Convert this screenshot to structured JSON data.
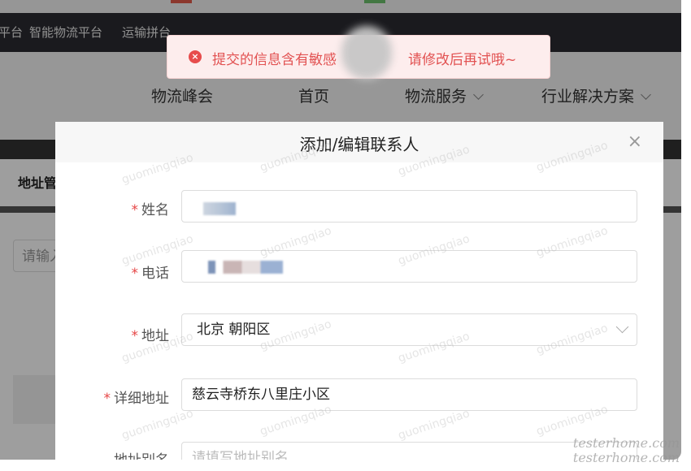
{
  "topbar": {
    "links": [
      "平台",
      "智能物流平台",
      "运输拼台"
    ]
  },
  "nav": {
    "items": [
      "物流峰会",
      "首页",
      "物流服务",
      "行业解决方案"
    ]
  },
  "page": {
    "left_tab": "地址管",
    "left_input_placeholder": "请输入"
  },
  "dialog": {
    "title": "添加/编辑联系人",
    "close_glyph": "×",
    "required_mark": "*",
    "fields": {
      "name_label": "姓名",
      "phone_label": "电话",
      "address_label": "地址",
      "address_value": "北京 朝阳区",
      "detail_label": "详细地址",
      "detail_value": "慈云寺桥东八里庄小区",
      "alias_label": "地址别名",
      "alias_placeholder": "请填写地址别名"
    }
  },
  "toast": {
    "icon_glyph": "×",
    "text_before": "提交的信息含有敏感",
    "text_after": "请修改后再试哦~",
    "color": "#e25252"
  },
  "watermark": {
    "text": "guomingqiao",
    "corner_line1": "testerhome.com",
    "corner_line2": "testerhome.com"
  },
  "icons": {
    "close": "close-icon",
    "error": "error-circle-icon",
    "chevron": "chevron-down-icon"
  }
}
